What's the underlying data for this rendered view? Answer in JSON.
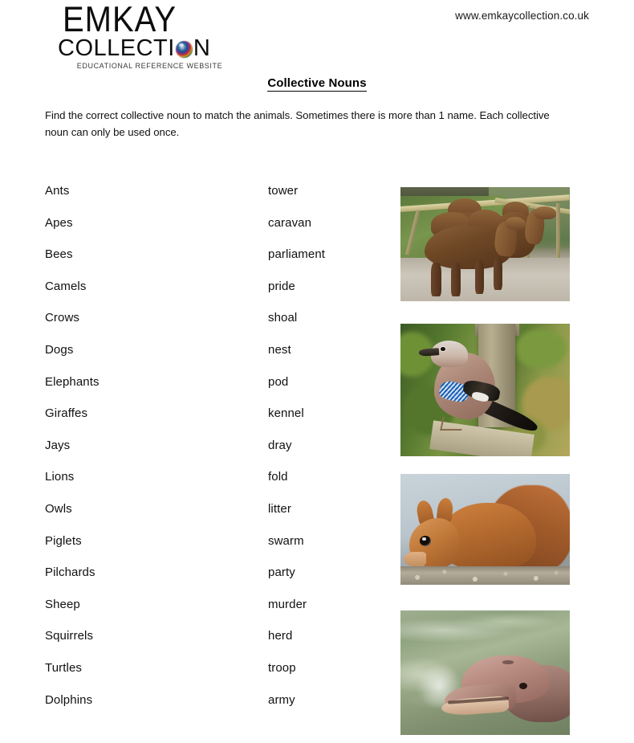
{
  "header": {
    "logo": {
      "line1": "EMKAY",
      "line2_before": "COLLECTI",
      "line2_after": "N",
      "lens_icon": "camera-lens-icon",
      "tagline": "EDUCATIONAL REFERENCE WEBSITE"
    },
    "site_url": "www.emkaycollection.co.uk"
  },
  "worksheet": {
    "title": "Collective Nouns",
    "instructions": "Find the correct collective noun to match the animals. Sometimes there is more than 1 name. Each collective noun can only be used once.",
    "rows": [
      {
        "animal": "Ants",
        "noun": "tower"
      },
      {
        "animal": "Apes",
        "noun": "caravan"
      },
      {
        "animal": "Bees",
        "noun": "parliament"
      },
      {
        "animal": "Camels",
        "noun": "pride"
      },
      {
        "animal": "Crows",
        "noun": "shoal"
      },
      {
        "animal": "Dogs",
        "noun": "nest"
      },
      {
        "animal": "Elephants",
        "noun": "pod"
      },
      {
        "animal": "Giraffes",
        "noun": "kennel"
      },
      {
        "animal": "Jays",
        "noun": "dray"
      },
      {
        "animal": "Lions",
        "noun": "fold"
      },
      {
        "animal": "Owls",
        "noun": "litter"
      },
      {
        "animal": "Piglets",
        "noun": "swarm"
      },
      {
        "animal": "Pilchards",
        "noun": "party"
      },
      {
        "animal": "Sheep",
        "noun": "murder"
      },
      {
        "animal": "Squirrels",
        "noun": "herd"
      },
      {
        "animal": "Turtles",
        "noun": "troop"
      },
      {
        "animal": "Dolphins",
        "noun": "army"
      }
    ]
  },
  "photos": [
    {
      "name": "camels-photo",
      "subject": "Three bactrian camels standing on wet concrete by a green field and wooden fence"
    },
    {
      "name": "jay-photo",
      "subject": "Eurasian jay with blue barred wing patch perched on a wooden post"
    },
    {
      "name": "squirrel-photo",
      "subject": "Red squirrel eating a seed on gravel ground"
    },
    {
      "name": "dolphin-photo",
      "subject": "Bottlenose dolphin head surfacing in green water"
    }
  ],
  "colors": {
    "text": "#111111",
    "logo_dark": "#0d0d0d",
    "page_background": "#ffffff"
  }
}
